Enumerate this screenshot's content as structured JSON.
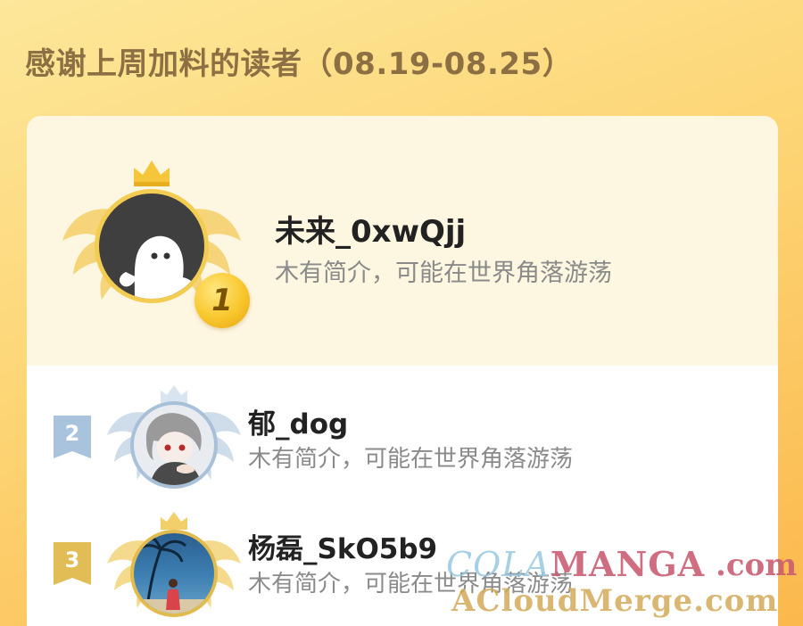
{
  "page": {
    "title": "感谢上周加料的读者（08.19-08.25）"
  },
  "leaderboard": [
    {
      "rank": "1",
      "name": "未来_0xwQjj",
      "desc": "木有简介，可能在世界角落游荡"
    },
    {
      "rank": "2",
      "name": "郁_dog",
      "desc": "木有简介，可能在世界角落游荡"
    },
    {
      "rank": "3",
      "name": "杨磊_SkO5b9",
      "desc": "木有简介，可能在世界角落游荡"
    }
  ],
  "watermark": {
    "cola": "COLA",
    "manga": "MANGA",
    "com": ".com",
    "line2": "ACloudMerge.com"
  },
  "colors": {
    "background": "#fdd575",
    "title": "#8c7044",
    "gold": "#f3cc52",
    "silver": "#a8c0d8",
    "bronze": "#e2bb4e"
  },
  "icons": {
    "crown": "crown-icon",
    "wings": "wing-icon",
    "medal": "medal-icon",
    "ribbon": "ribbon-icon"
  }
}
